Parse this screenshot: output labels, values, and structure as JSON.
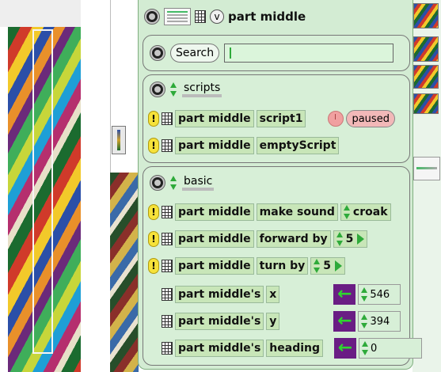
{
  "header": {
    "title": "part middle",
    "view_button": "v"
  },
  "search": {
    "button_label": "Search",
    "value": ""
  },
  "scripts": {
    "category": "scripts",
    "rows": [
      {
        "object": "part middle",
        "name": "script1",
        "status": "paused"
      },
      {
        "object": "part middle",
        "name": "emptyScript"
      }
    ]
  },
  "basic": {
    "category": "basic",
    "commands": [
      {
        "object": "part middle",
        "name": "make sound",
        "value": "croak"
      },
      {
        "object": "part middle",
        "name": "forward by",
        "value": "5"
      },
      {
        "object": "part middle",
        "name": "turn by",
        "value": "5"
      }
    ],
    "getters": [
      {
        "object": "part middle's",
        "name": "x",
        "value": "546"
      },
      {
        "object": "part middle's",
        "name": "y",
        "value": "394"
      },
      {
        "object": "part middle's",
        "name": "heading",
        "value": "0"
      }
    ]
  },
  "icons": {
    "menu": "halo-menu-icon",
    "thumbnail": "sprite-thumbnail-icon",
    "tile": "tile-grid-icon",
    "bang": "exclamation-icon",
    "arrows": "up-down-arrows-icon",
    "play": "play-triangle-icon",
    "clock": "clock-icon",
    "assign": "green-left-arrow-icon"
  },
  "colors": {
    "panel": "#d3ecd3",
    "tile": "#c8e6b8",
    "paused": "#f2b8b8",
    "assign_bg": "#6a1d84",
    "bang": "#f6e23a"
  }
}
